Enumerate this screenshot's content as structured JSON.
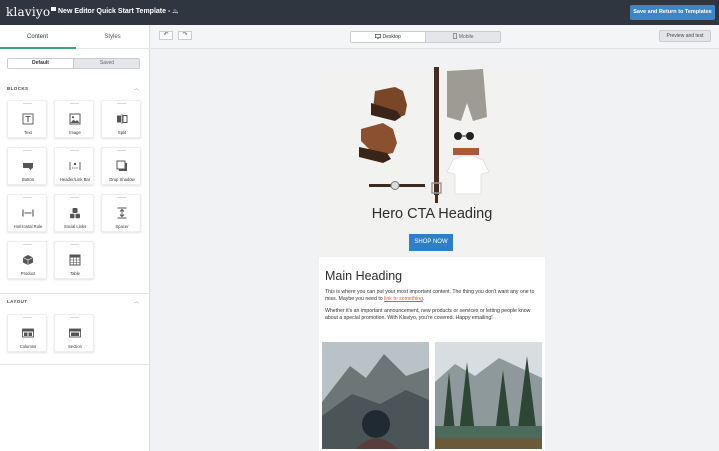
{
  "header": {
    "logo": "klaviyo",
    "template_title": "New Editor Quick Start Template - ...",
    "save_label": "Save and Return to Templates"
  },
  "sidebar": {
    "tabs": [
      {
        "label": "Content",
        "active": true
      },
      {
        "label": "Styles",
        "active": false
      }
    ],
    "segment": [
      "Default",
      "Saved"
    ],
    "blocks_label": "BLOCKS",
    "blocks": [
      {
        "label": "Text",
        "icon": "text-icon"
      },
      {
        "label": "Image",
        "icon": "image-icon"
      },
      {
        "label": "Split",
        "icon": "split-icon"
      },
      {
        "label": "Button",
        "icon": "button-icon"
      },
      {
        "label": "Header/Link Bar",
        "icon": "header-link-bar-icon"
      },
      {
        "label": "Drop Shadow",
        "icon": "drop-shadow-icon"
      },
      {
        "label": "Horizontal Rule",
        "icon": "horizontal-rule-icon"
      },
      {
        "label": "Social Links",
        "icon": "social-links-icon"
      },
      {
        "label": "Spacer",
        "icon": "spacer-icon"
      },
      {
        "label": "Product",
        "icon": "product-icon"
      },
      {
        "label": "Table",
        "icon": "table-icon"
      }
    ],
    "layout_label": "LAYOUT",
    "layout_blocks": [
      {
        "label": "Columns",
        "icon": "columns-icon"
      },
      {
        "label": "Section",
        "icon": "section-icon"
      }
    ]
  },
  "toolbar": {
    "undo_icon": "undo-icon",
    "redo_icon": "redo-icon",
    "device_options": [
      {
        "label": "Desktop",
        "icon": "desktop-icon",
        "active": true
      },
      {
        "label": "Mobile",
        "icon": "mobile-icon",
        "active": false
      }
    ],
    "preview_label": "Preview and test"
  },
  "email": {
    "hero_heading": "Hero CTA Heading",
    "cta_label": "SHOP NOW",
    "main_heading": "Main Heading",
    "p1_before_link": "This is where you can put your most important content. The thing you don't want any one to miss. Maybe you need to ",
    "p1_link": "link to something",
    "p1_after_link": ".",
    "p2": "Whether it's an important announcement, new products or services or letting people know about a special promotion. With Klaviyo, you're covered. Happy emailing!"
  },
  "colors": {
    "topbar_bg": "#2f3640",
    "primary_button": "#3b86c9",
    "tab_accent": "#3ba676",
    "cta_button": "#2f7fc6",
    "link": "#e0632b"
  }
}
